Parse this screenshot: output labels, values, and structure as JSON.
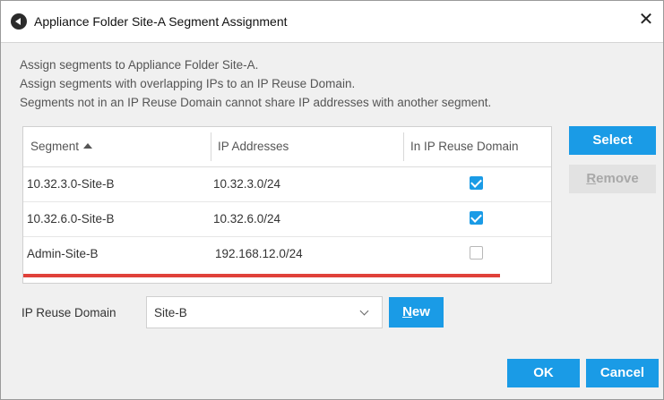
{
  "window": {
    "title": "Appliance Folder Site-A Segment Assignment",
    "app_icon": "back-arrow-circle-icon",
    "close_icon": "close-icon"
  },
  "description": [
    "Assign segments to Appliance Folder Site-A.",
    "Assign segments with overlapping IPs to an IP Reuse Domain.",
    "Segments not in an IP Reuse Domain cannot share IP addresses with another segment."
  ],
  "table": {
    "columns": [
      "Segment",
      "IP Addresses",
      "In IP Reuse Domain"
    ],
    "sort_column": "Segment",
    "sort_direction": "ascending",
    "rows": [
      {
        "segment": "10.32.3.0-Site-B",
        "ip": "10.32.3.0/24",
        "in_domain": true
      },
      {
        "segment": "10.32.6.0-Site-B",
        "ip": "10.32.6.0/24",
        "in_domain": true
      },
      {
        "segment": "Admin-Site-B",
        "ip": "192.168.12.0/24",
        "in_domain": false
      }
    ]
  },
  "buttons": {
    "select": "Select",
    "remove_first": "R",
    "remove_rest": "emove",
    "new_first": "N",
    "new_rest": "ew",
    "ok": "OK",
    "cancel": "Cancel"
  },
  "ip_reuse_domain": {
    "label": "IP Reuse Domain",
    "value": "Site-B"
  },
  "colors": {
    "accent": "#1a9be6",
    "highlight_underline": "#e0413a"
  }
}
